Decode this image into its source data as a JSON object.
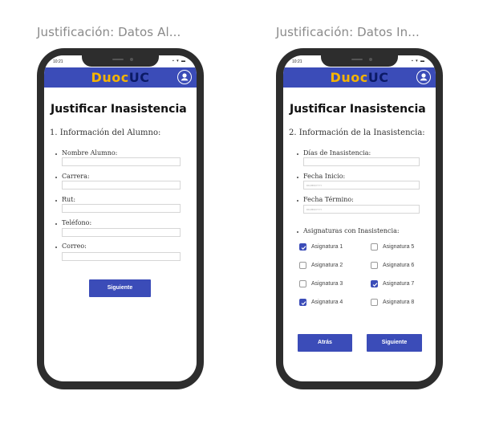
{
  "frames": [
    {
      "label": "Justificación: Datos Al..."
    },
    {
      "label": "Justificación: Datos In..."
    }
  ],
  "status_bar": {
    "time": "10:21",
    "icons": "▪︎ ▾ ▬"
  },
  "app_bar": {
    "logo_part1": "Duoc",
    "logo_part2": "UC"
  },
  "screen1": {
    "title": "Justificar Inasistencia",
    "section": "1. Información del Alumno:",
    "fields": [
      {
        "label": "Nombre Alumno:",
        "value": ""
      },
      {
        "label": "Carrera:",
        "value": ""
      },
      {
        "label": "Rut:",
        "value": ""
      },
      {
        "label": "Teléfono:",
        "value": ""
      },
      {
        "label": "Correo:",
        "value": ""
      }
    ],
    "next_button": "Siguiente"
  },
  "screen2": {
    "title": "Justificar Inasistencia",
    "section": "2. Información de la Inasistencia:",
    "fields": [
      {
        "label": "Días de Inasistencia:",
        "placeholder": ""
      },
      {
        "label": "Fecha Inicio:",
        "placeholder": "DD/MM/YYYY"
      },
      {
        "label": "Fecha Término:",
        "placeholder": "DD/MM/YYYY"
      }
    ],
    "subjects_label": "Asignaturas con Inasistencia:",
    "subjects": [
      {
        "label": "Asignatura 1",
        "checked": true
      },
      {
        "label": "Asignatura 2",
        "checked": false
      },
      {
        "label": "Asignatura 3",
        "checked": false
      },
      {
        "label": "Asignatura 4",
        "checked": true
      },
      {
        "label": "Asignatura 5",
        "checked": false
      },
      {
        "label": "Asignatura 6",
        "checked": false
      },
      {
        "label": "Asignatura 7",
        "checked": true
      },
      {
        "label": "Asignatura 8",
        "checked": false
      }
    ],
    "back_button": "Atrás",
    "next_button": "Siguiente"
  },
  "colors": {
    "primary": "#3b4cb8",
    "logo_yellow": "#f5b400",
    "logo_navy": "#0b1a66",
    "phone_frame": "#2d2d2d"
  }
}
